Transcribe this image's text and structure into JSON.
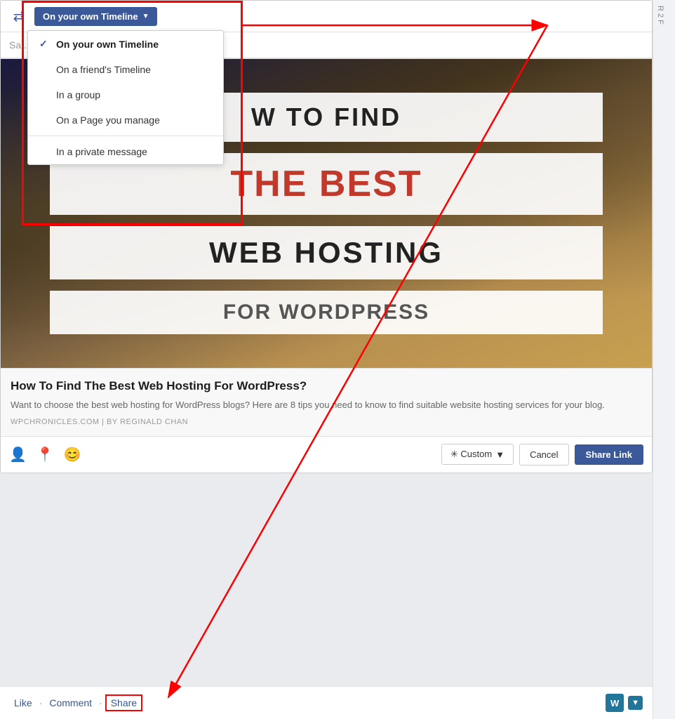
{
  "header": {
    "dropdown_label": "On your own Timeline",
    "dropdown_arrow": "▼"
  },
  "dropdown_menu": {
    "items": [
      {
        "id": "own-timeline",
        "label": "On your own Timeline",
        "selected": true
      },
      {
        "id": "friend-timeline",
        "label": "On a friend's Timeline",
        "selected": false
      },
      {
        "id": "in-group",
        "label": "In a group",
        "selected": false
      },
      {
        "id": "page-manage",
        "label": "On a Page you manage",
        "selected": false
      },
      {
        "id": "private-message",
        "label": "In a private message",
        "selected": false
      }
    ]
  },
  "content": {
    "image_text_top": "W TO FIND",
    "image_text_mid": "THE BEST",
    "image_text_bottom": "WEB HOSTING",
    "image_text_sub": "FOR WORDPRESS",
    "title": "How To Find The Best Web Hosting For WordPress?",
    "description": "Want to choose the best web hosting for WordPress blogs? Here are 8 tips you need to know to find suitable website hosting services for your blog.",
    "source": "WPCHRONICLES.COM",
    "source_separator": "|",
    "author": "BY REGINALD CHAN"
  },
  "footer": {
    "custom_label": "✳ Custom",
    "custom_arrow": "▼",
    "cancel_label": "Cancel",
    "share_link_label": "Share Link"
  },
  "action_bar": {
    "like_label": "Like",
    "comment_label": "Comment",
    "share_label": "Share",
    "dot": "·"
  },
  "icons": {
    "person_add": "👤+",
    "location": "📍",
    "emoji": "😊",
    "share_icon": "⇄",
    "wp_icon": "W"
  },
  "sidebar": {
    "partial_texts": [
      "R",
      "2",
      "F"
    ]
  }
}
